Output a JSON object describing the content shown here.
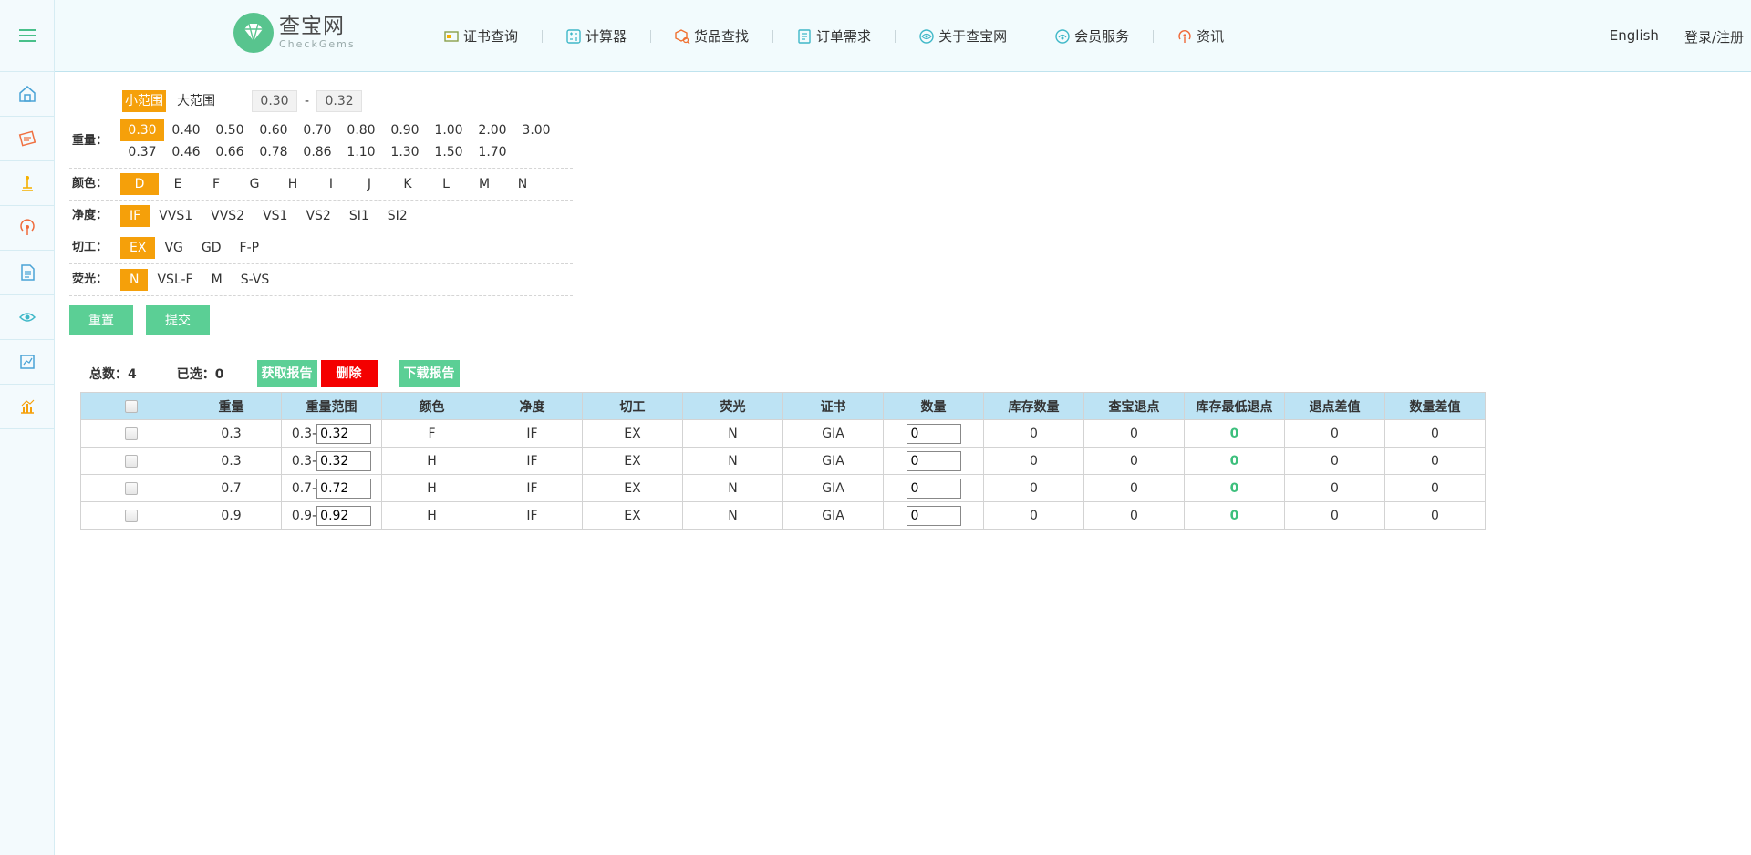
{
  "brand": {
    "name_cn": "查宝网",
    "name_en": "CheckGems",
    "color": "#58c48e"
  },
  "nav": [
    {
      "label": "证书查询",
      "icon": "certificate-icon"
    },
    {
      "label": "计算器",
      "icon": "calculator-icon"
    },
    {
      "label": "货品查找",
      "icon": "box-search-icon"
    },
    {
      "label": "订单需求",
      "icon": "order-icon"
    },
    {
      "label": "关于查宝网",
      "icon": "eye-icon"
    },
    {
      "label": "会员服务",
      "icon": "member-icon"
    },
    {
      "label": "资讯",
      "icon": "broadcast-icon"
    }
  ],
  "header_right": {
    "language": "English",
    "login": "登录/注册"
  },
  "filter": {
    "range_tabs": [
      "小范围",
      "大范围"
    ],
    "range_from": "0.30",
    "range_dash": "-",
    "range_to": "0.32",
    "weight_label": "重量：",
    "weight_options": [
      "0.30",
      "0.40",
      "0.50",
      "0.60",
      "0.70",
      "0.80",
      "0.90",
      "1.00",
      "2.00",
      "3.00",
      "0.37",
      "0.46",
      "0.66",
      "0.78",
      "0.86",
      "1.10",
      "1.30",
      "1.50",
      "1.70"
    ],
    "color_label": "颜色：",
    "color_options": [
      "D",
      "E",
      "F",
      "G",
      "H",
      "I",
      "J",
      "K",
      "L",
      "M",
      "N"
    ],
    "clarity_label": "净度：",
    "clarity_options": [
      "IF",
      "VVS1",
      "VVS2",
      "VS1",
      "VS2",
      "SI1",
      "SI2"
    ],
    "cut_label": "切工：",
    "cut_options": [
      "EX",
      "VG",
      "GD",
      "F-P"
    ],
    "fluor_label": "荧光：",
    "fluor_options": [
      "N",
      "VSL-F",
      "M",
      "S-VS"
    ],
    "reset": "重置",
    "submit": "提交"
  },
  "summary": {
    "total": "总数：4",
    "selected": "已选：0",
    "get_report": "获取报告",
    "delete": "删除",
    "download_report": "下载报告"
  },
  "table": {
    "headers": [
      "重量",
      "重量范围",
      "颜色",
      "净度",
      "切工",
      "荧光",
      "证书",
      "数量",
      "库存数量",
      "查宝退点",
      "库存最低退点",
      "退点差值",
      "数量差值"
    ],
    "rows": [
      {
        "weight": "0.3",
        "range_prefix": "0.3-",
        "range_to": "0.32",
        "color": "F",
        "clarity": "IF",
        "cut": "EX",
        "fluor": "N",
        "cert": "GIA",
        "qty": "0",
        "stock": "0",
        "discount": "0",
        "min_discount": "0",
        "diff": "0",
        "qty_diff": "0"
      },
      {
        "weight": "0.3",
        "range_prefix": "0.3-",
        "range_to": "0.32",
        "color": "H",
        "clarity": "IF",
        "cut": "EX",
        "fluor": "N",
        "cert": "GIA",
        "qty": "0",
        "stock": "0",
        "discount": "0",
        "min_discount": "0",
        "diff": "0",
        "qty_diff": "0"
      },
      {
        "weight": "0.7",
        "range_prefix": "0.7-",
        "range_to": "0.72",
        "color": "H",
        "clarity": "IF",
        "cut": "EX",
        "fluor": "N",
        "cert": "GIA",
        "qty": "0",
        "stock": "0",
        "discount": "0",
        "min_discount": "0",
        "diff": "0",
        "qty_diff": "0"
      },
      {
        "weight": "0.9",
        "range_prefix": "0.9-",
        "range_to": "0.92",
        "color": "H",
        "clarity": "IF",
        "cut": "EX",
        "fluor": "N",
        "cert": "GIA",
        "qty": "0",
        "stock": "0",
        "discount": "0",
        "min_discount": "0",
        "diff": "0",
        "qty_diff": "0"
      }
    ]
  },
  "colors": {
    "accent_orange": "#f5a00a",
    "accent_green": "#5bcf95",
    "danger": "#f40000",
    "table_header": "#bde3f4"
  }
}
